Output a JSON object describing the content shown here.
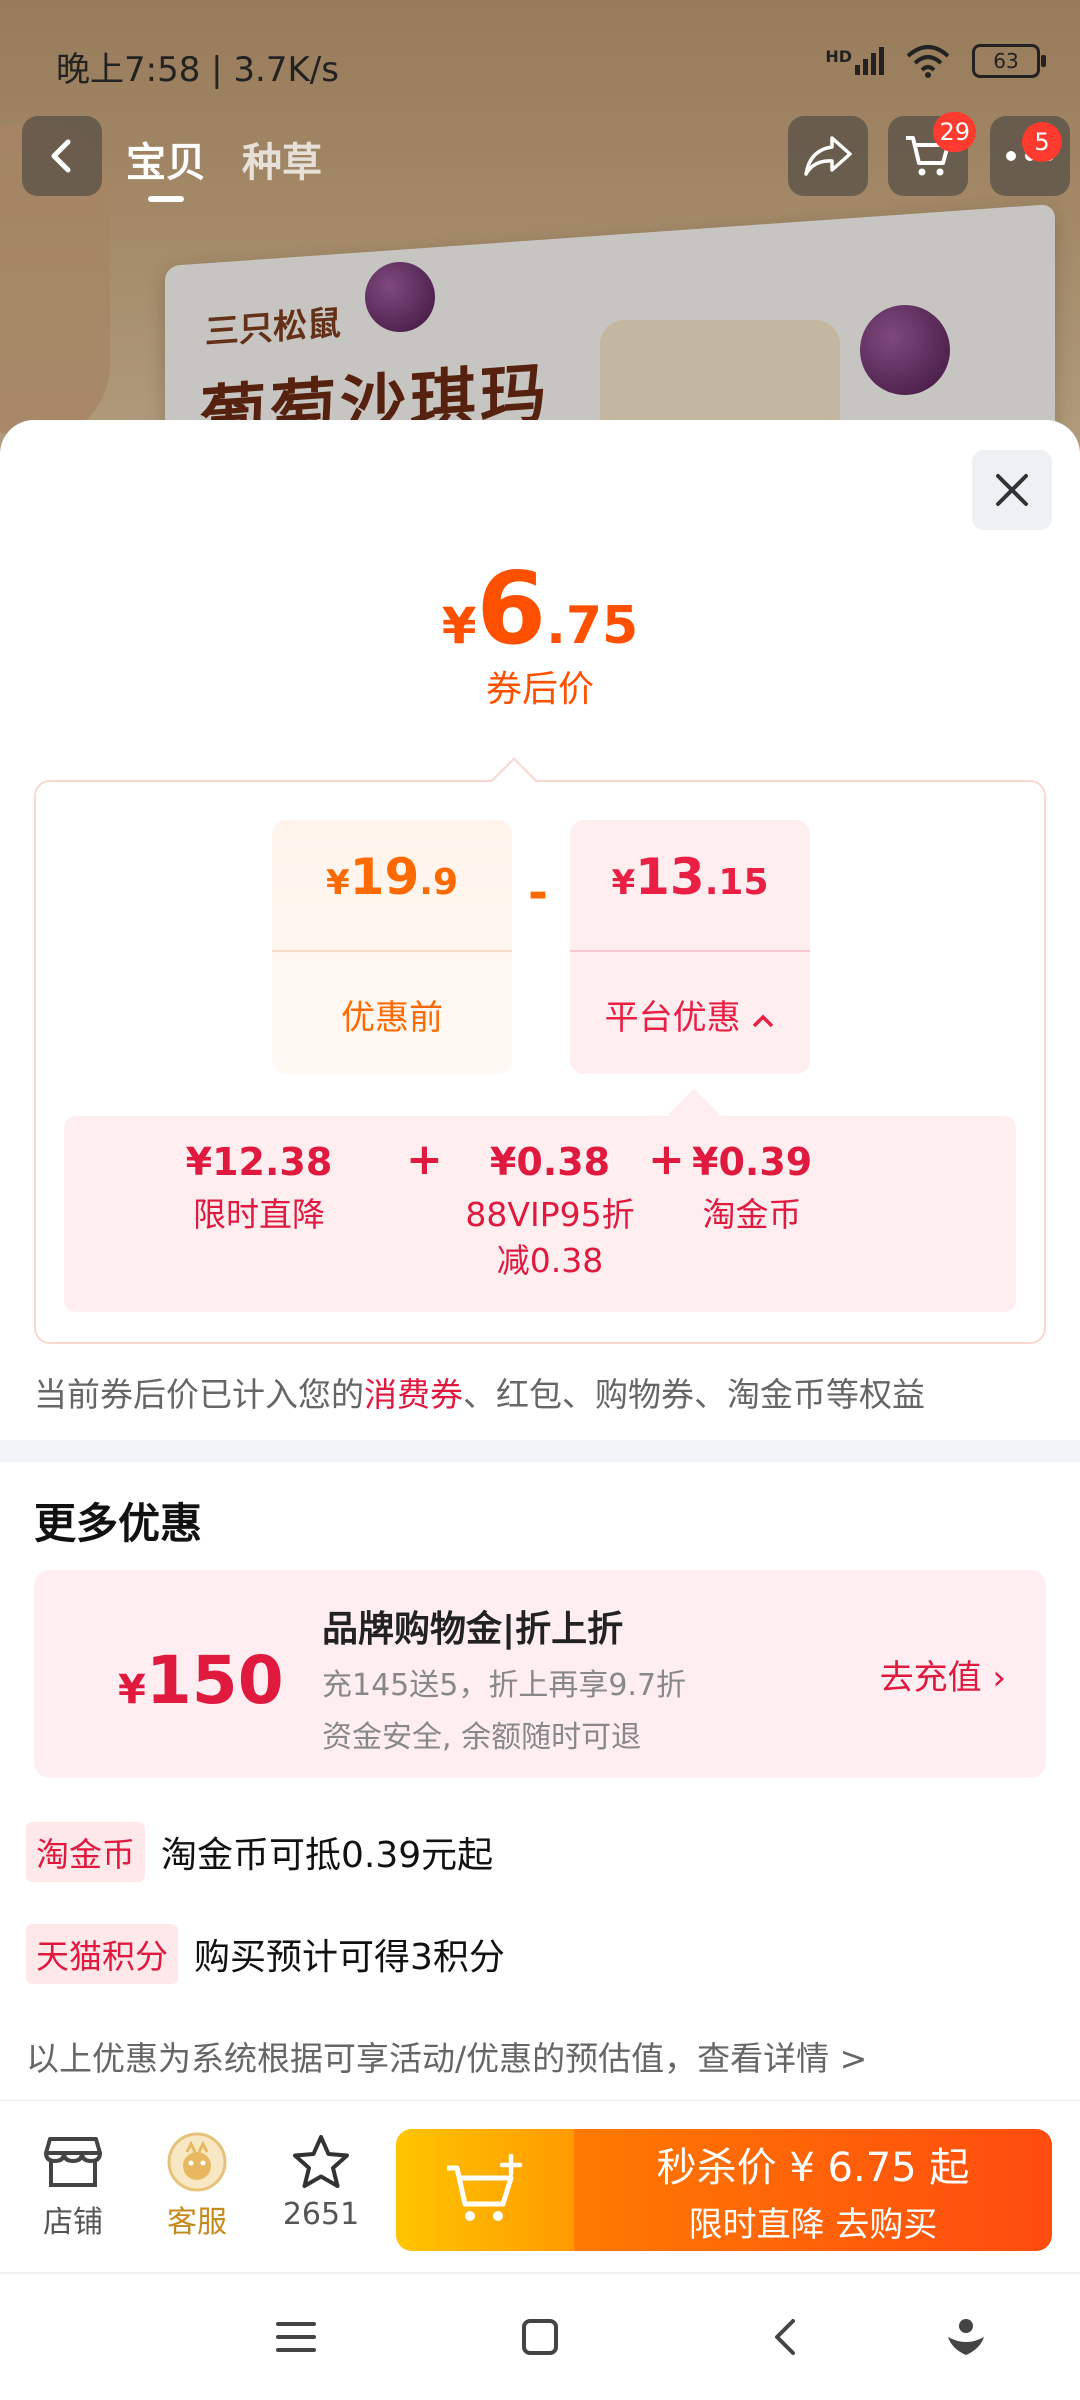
{
  "status_bar": {
    "time": "晚上7:58 | 3.7K/s",
    "network": "HD",
    "battery": "63"
  },
  "nav": {
    "tabs": [
      "宝贝",
      "种草"
    ],
    "cart_badge": "29",
    "more_badge": "5"
  },
  "product_bg": {
    "brand": "三只松鼠",
    "name": "葡萄沙琪玛"
  },
  "sheet": {
    "final_price": {
      "currency": "¥",
      "integer": "6",
      "decimal": ".75",
      "caption": "券后价"
    },
    "before": {
      "currency": "¥",
      "integer": "19",
      "decimal": ".9",
      "label": "优惠前"
    },
    "operator_minus": "-",
    "platform": {
      "currency": "¥",
      "integer": "13",
      "decimal": ".15",
      "label": "平台优惠"
    },
    "breakdown": [
      {
        "value": "¥12.38",
        "label": "限时直降"
      },
      {
        "value": "¥0.38",
        "label": "88VIP95折",
        "label2": "减0.38"
      },
      {
        "value": "¥0.39",
        "label": "淘金币"
      }
    ],
    "operator_plus": "+",
    "note_prefix": "当前券后价已计入您的",
    "note_highlight": "消费券",
    "note_suffix": "、红包、购物券、淘金币等权益",
    "more_title": "更多优惠",
    "promo": {
      "currency": "¥",
      "amount": "150",
      "title": "品牌购物金|折上折",
      "line1": "充145送5，折上再享9.7折",
      "line2": "资金安全, 余额随时可退",
      "action": "去充值 ›"
    },
    "coin": {
      "tag": "淘金币",
      "text": "淘金币可抵0.39元起"
    },
    "points": {
      "tag": "天猫积分",
      "text": "购买预计可得3积分"
    },
    "estimate": "以上优惠为系统根据可享活动/优惠的预估值，查看详情 >"
  },
  "action_bar": {
    "shop": "店铺",
    "service": "客服",
    "favorites": "2651",
    "buy_line1": "秒杀价 ¥ 6.75 起",
    "buy_line2": "限时直降  去购买"
  },
  "colors": {
    "accent_orange": "#ff5000",
    "accent_red": "#e0193f"
  }
}
